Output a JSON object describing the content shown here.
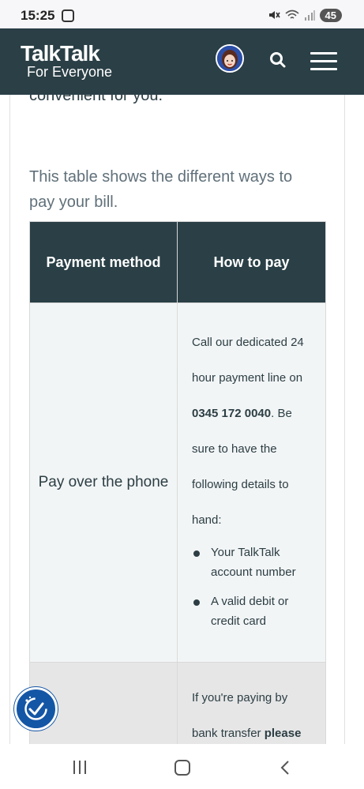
{
  "status_bar": {
    "time": "15:25",
    "battery": "45"
  },
  "header": {
    "logo_main": "TalkTalk",
    "logo_sub": "For Everyone"
  },
  "content": {
    "cut_off_text": "convenient for you.",
    "intro": "This table shows the different ways to pay your bill.",
    "table": {
      "headers": [
        "Payment method",
        "How to pay"
      ],
      "rows": [
        {
          "method": "Pay over the phone",
          "how_lines": [
            "Call our dedicated 24",
            "hour payment line on",
            "sure to have the",
            "following details to",
            "hand:"
          ],
          "phone": "0345 172 0040",
          "phone_suffix": ". Be",
          "bullets": [
            "Your TalkTalk account number",
            "A valid debit or credit card"
          ]
        },
        {
          "method": "",
          "how_line1": "If you're paying by",
          "how_line2_plain": "bank transfer ",
          "how_line2_bold": "please"
        }
      ]
    }
  },
  "icons": {
    "status_left": "screen-record-icon",
    "mute": "mute-icon",
    "wifi": "wifi-icon",
    "signal": "signal-icon",
    "search": "search-icon",
    "menu": "hamburger-menu-icon",
    "accessibility": "accessibility-icon",
    "nav_recents": "recents-icon",
    "nav_home": "home-icon",
    "nav_back": "back-icon"
  },
  "colors": {
    "brand_dark": "#2a3f46",
    "accessibility_blue": "#1456a6",
    "row_light": "#f2f5f6",
    "row_grey": "#e6e6e6"
  }
}
